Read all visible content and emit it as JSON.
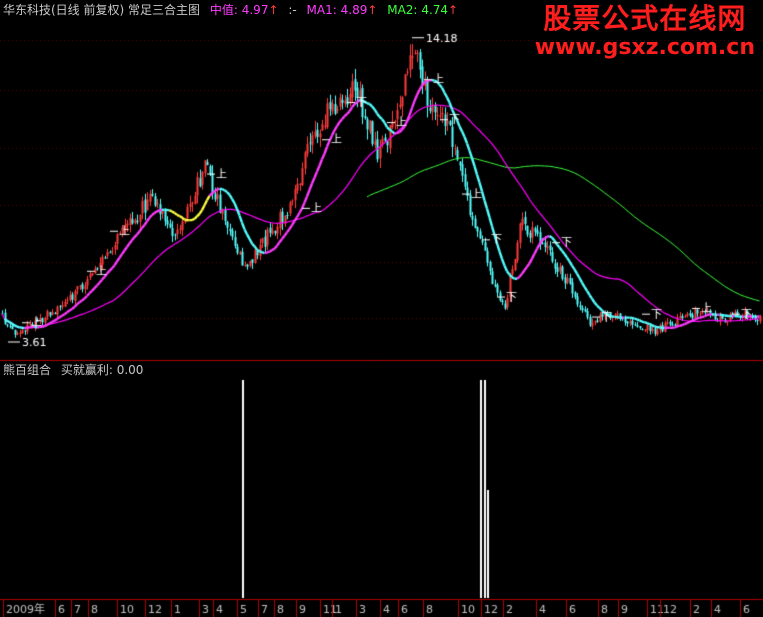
{
  "header": {
    "security": "华东科技(日线 前复权)",
    "formula": "常足三合主图",
    "mid_label": "中值:",
    "mid_value": "4.97",
    "sep": ":-",
    "ma1_label": "MA1:",
    "ma1_value": "4.89",
    "ma2_label": "MA2:",
    "ma2_value": "4.74",
    "arrow": "↑"
  },
  "sub_header": {
    "indicator": "熊百组合",
    "label": "买就赢利:",
    "value": "0.00"
  },
  "watermark": {
    "line1": "股票公式在线网",
    "line2": "www.gsxz.com.cn"
  },
  "annotations": {
    "high": "14.18",
    "low": "3.61",
    "buy": "上",
    "sell": "下"
  },
  "x_axis": {
    "ticks": [
      "2009年",
      "6",
      "7",
      "8",
      "10",
      "12",
      "1",
      "3",
      "4",
      "5",
      "7",
      "8",
      "9",
      "11",
      "1",
      "3",
      "4",
      "6",
      "8",
      "10",
      "12",
      "2",
      "4",
      "6",
      "8",
      "9",
      "11",
      "12",
      "2",
      "4",
      "6"
    ]
  },
  "colors": {
    "up": "#ff3c3c",
    "down": "#54ffff",
    "mid_line": "#54ffff",
    "ma1": "#ff00ff",
    "ma2": "#3cff3c",
    "signal": "#ffffff",
    "axis": "#b00000",
    "watermark": "#ff1e1e"
  }
}
